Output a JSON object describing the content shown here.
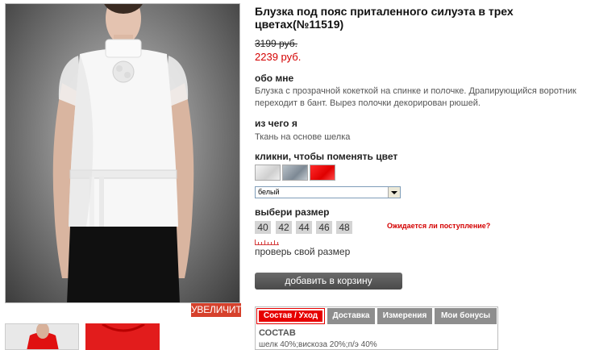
{
  "product": {
    "title": "Блузка под пояс приталенного силуэта в трех цветах(№11519)",
    "old_price": "3199 руб.",
    "new_price": "2239 руб."
  },
  "gallery": {
    "zoom_label": "УВЕЛИЧИТЬ",
    "main_image": "model-white-blouse-photo",
    "thumbnails": [
      "thumb-back-view",
      "thumb-red-blouse"
    ]
  },
  "about": {
    "heading": "обо мне",
    "text": "Блузка с прозрачной кокеткой на спинке и полочке. Драпирующийся воротник переходит в бант. Вырез полочки декорирован рюшей."
  },
  "material": {
    "heading": "из чего я",
    "text": "Ткань на основе шелка"
  },
  "color": {
    "heading": "кликни, чтобы поменять цвет",
    "swatches": [
      {
        "name": "white",
        "color": "#e8e8e8"
      },
      {
        "name": "grey",
        "color": "#8d98a2"
      },
      {
        "name": "red",
        "color": "#f01010"
      }
    ],
    "selected": "белый"
  },
  "size": {
    "heading": "выбери размер",
    "options": [
      "40",
      "42",
      "44",
      "46",
      "48"
    ],
    "expected_link": "Ожидается ли поступление?",
    "check_size_link": "проверь свой размер"
  },
  "cart": {
    "add_label": "добавить в корзину"
  },
  "tabs": {
    "items": [
      "Состав / Уход",
      "Доставка",
      "Измерения",
      "Мои бонусы"
    ],
    "active": 0,
    "content_heading": "СОСТАВ",
    "content_text": "шелк 40%;вискоза 20%;п/э 40%"
  },
  "colors": {
    "accent": "#e60000",
    "price": "#d40000",
    "tab_inactive": "#8e8e8e",
    "cart_button": "#555555",
    "size_chip": "#d4d4d4"
  }
}
